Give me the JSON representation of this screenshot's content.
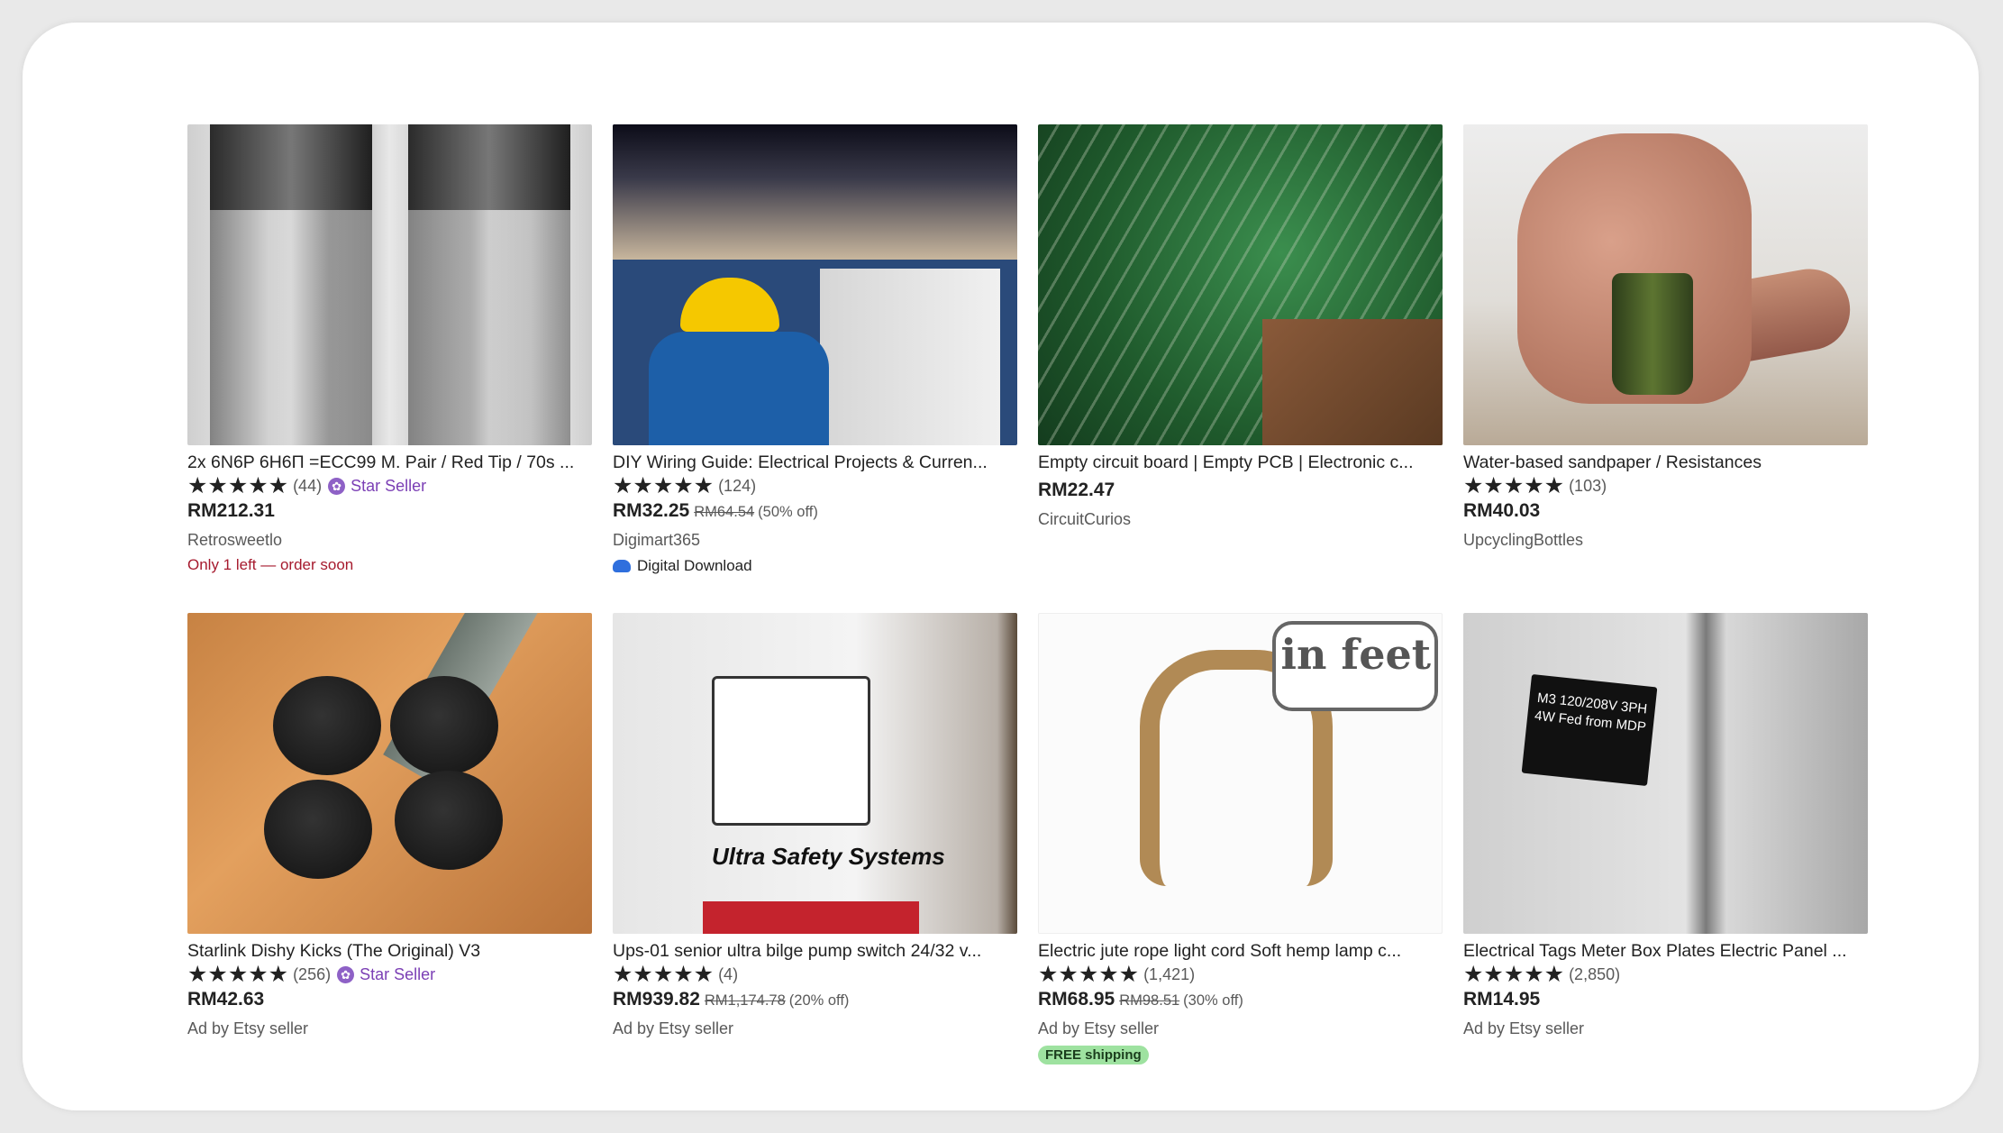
{
  "listings": [
    {
      "title": "2x 6N6P 6Н6П =ECC99 M. Pair / Red Tip / 70s ...",
      "stars": "★★★★★",
      "review_count": "(44)",
      "star_seller": "Star Seller",
      "price": "RM212.31",
      "shop": "Retrosweetlo",
      "note": "Only 1 left — order soon"
    },
    {
      "title": "DIY Wiring Guide: Electrical Projects & Curren...",
      "stars": "★★★★★",
      "rating_value": 4.5,
      "review_count": "(124)",
      "price": "RM32.25",
      "original_price": "RM64.54",
      "discount": "(50% off)",
      "shop": "Digimart365",
      "badge": "Digital Download"
    },
    {
      "title": "Empty circuit board | Empty PCB | Electronic c...",
      "price": "RM22.47",
      "shop": "CircuitCurios"
    },
    {
      "title": "Water-based sandpaper / Resistances",
      "stars": "★★★★★",
      "review_count": "(103)",
      "price": "RM40.03",
      "shop": "UpcyclingBottles"
    },
    {
      "title": "Starlink Dishy Kicks (The Original) V3",
      "stars": "★★★★★",
      "review_count": "(256)",
      "star_seller": "Star Seller",
      "price": "RM42.63",
      "shop": "Ad by Etsy seller"
    },
    {
      "title": "Ups-01 senior ultra bilge pump switch 24/32 v...",
      "stars": "★★★★★",
      "review_count": "(4)",
      "price": "RM939.82",
      "original_price": "RM1,174.78",
      "discount": "(20% off)",
      "shop": "Ad by Etsy seller",
      "image_text": "Ultra Safety Systems"
    },
    {
      "title": "Electric jute rope light cord Soft hemp lamp c...",
      "stars": "★★★★★",
      "review_count": "(1,421)",
      "price": "RM68.95",
      "original_price": "RM98.51",
      "discount": "(30% off)",
      "shop": "Ad by Etsy seller",
      "badge": "FREE shipping",
      "image_text": "in feet"
    },
    {
      "title": "Electrical Tags Meter Box Plates Electric Panel ...",
      "stars": "★★★★★",
      "review_count": "(2,850)",
      "price": "RM14.95",
      "shop": "Ad by Etsy seller",
      "image_text": "M3 120/208V 3PH 4W Fed from MDP"
    }
  ],
  "colors": {
    "star_seller": "#7b3fb5",
    "urgent": "#a61a2e",
    "free_shipping_bg": "#9ee2a0",
    "digital_icon": "#2f6fdd"
  }
}
